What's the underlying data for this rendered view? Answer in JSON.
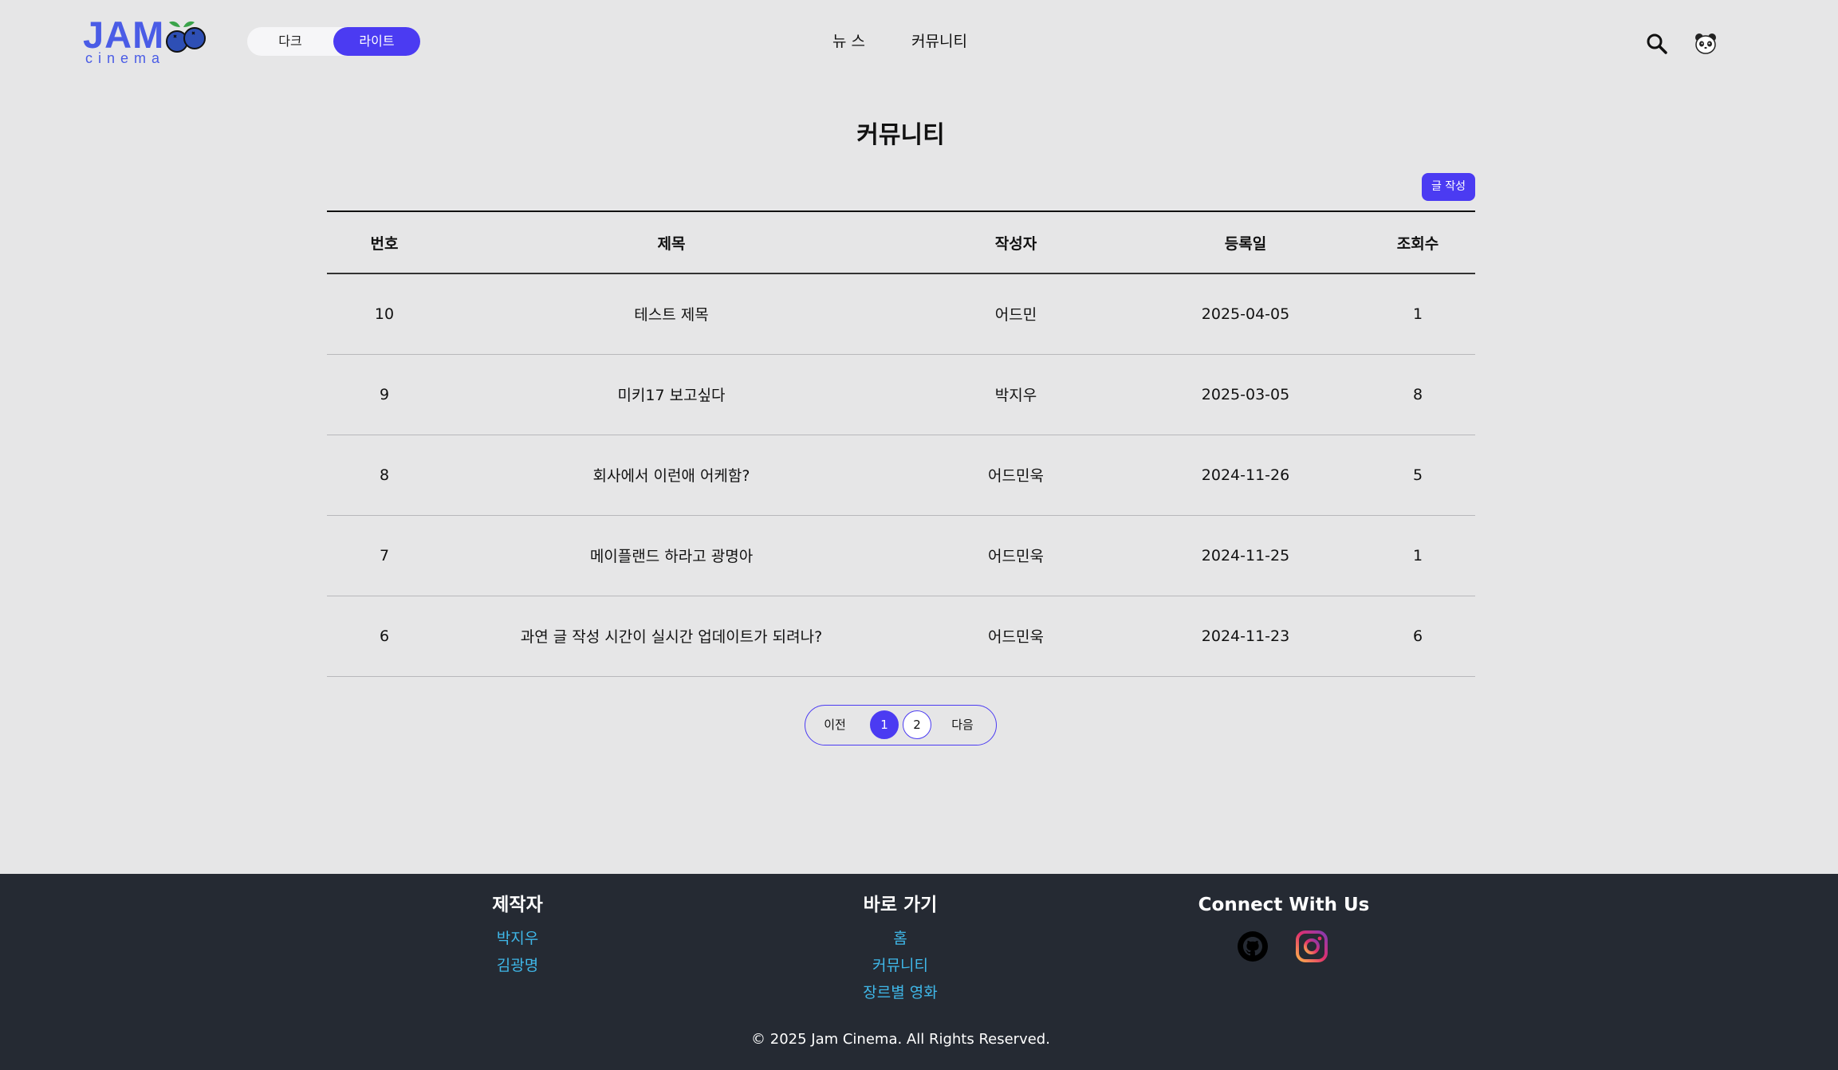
{
  "header": {
    "logo": {
      "word": "JAM",
      "sub": "cinema"
    },
    "theme": {
      "dark_label": "다크",
      "light_label": "라이트",
      "selected": "라이트"
    },
    "nav": [
      {
        "label": "뉴 스"
      },
      {
        "label": "커뮤니티"
      }
    ],
    "icons": [
      "search-icon",
      "panda-avatar-icon"
    ]
  },
  "main": {
    "title": "커뮤니티",
    "write_button": "글 작성",
    "table": {
      "headers": [
        "번호",
        "제목",
        "작성자",
        "등록일",
        "조회수"
      ],
      "rows": [
        [
          "10",
          "테스트 제목",
          "어드민",
          "2025-04-05",
          "1"
        ],
        [
          "9",
          "미키17 보고싶다",
          "박지우",
          "2025-03-05",
          "8"
        ],
        [
          "8",
          "회사에서 이런애 어케함?",
          "어드민욱",
          "2024-11-26",
          "5"
        ],
        [
          "7",
          "메이플랜드 하라고 광명아",
          "어드민욱",
          "2024-11-25",
          "1"
        ],
        [
          "6",
          "과연 글 작성 시간이 실시간 업데이트가 되려나?",
          "어드민욱",
          "2024-11-23",
          "6"
        ]
      ]
    },
    "pagination": {
      "prev": "이전",
      "pages": [
        "1",
        "2"
      ],
      "current": "1",
      "next": "다음"
    }
  },
  "footer": {
    "makers": {
      "heading": "제작자",
      "links": [
        "박지우",
        "김광명"
      ]
    },
    "shortcuts": {
      "heading": "바로 가기",
      "links": [
        "홈",
        "커뮤니티",
        "장르별 영화"
      ]
    },
    "connect": {
      "heading": "Connect With Us",
      "icons": [
        "github-icon",
        "instagram-icon"
      ]
    },
    "copyright": "© 2025 Jam Cinema. All Rights Reserved."
  },
  "colors": {
    "accent": "#4b3bf2",
    "logo": "#4a5ce6",
    "page_bg": "#e6e6e7",
    "footer_bg": "#252a33",
    "footer_link": "#3fb7e8"
  }
}
